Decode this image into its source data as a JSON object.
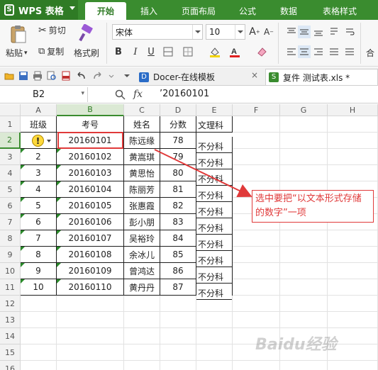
{
  "app": {
    "name": "WPS 表格"
  },
  "tabs": [
    "开始",
    "插入",
    "页面布局",
    "公式",
    "数据",
    "表格样式"
  ],
  "ribbon": {
    "cut": "剪切",
    "paste": "粘贴",
    "copy": "复制",
    "format_painter": "格式刷",
    "font_name": "宋体",
    "font_size": "10",
    "bold": "B",
    "italic": "I",
    "underline": "U",
    "merge": "合"
  },
  "doc_tabs": [
    {
      "label": "Docer-在线模板"
    },
    {
      "label": "复件 测试表.xls *"
    }
  ],
  "formula_bar": {
    "cell_ref": "B2",
    "fx": "fx",
    "content": "’20160101"
  },
  "columns": [
    "A",
    "B",
    "C",
    "D",
    "E",
    "F",
    "G",
    "H"
  ],
  "rows": [
    "1",
    "2",
    "3",
    "4",
    "5",
    "6",
    "7",
    "8",
    "9",
    "10",
    "11",
    "12",
    "13",
    "14",
    "15",
    "16"
  ],
  "table": {
    "headers": [
      "班级",
      "考号",
      "姓名",
      "分数",
      "文理科"
    ],
    "data": [
      [
        "",
        "20160101",
        "陈远缘",
        "78",
        "不分科"
      ],
      [
        "2",
        "20160102",
        "黄嵩琪",
        "79",
        "不分科"
      ],
      [
        "3",
        "20160103",
        "黄思怡",
        "80",
        "不分科"
      ],
      [
        "4",
        "20160104",
        "陈丽芳",
        "81",
        "不分科"
      ],
      [
        "5",
        "20160105",
        "张惠霞",
        "82",
        "不分科"
      ],
      [
        "6",
        "20160106",
        "彭小朋",
        "83",
        "不分科"
      ],
      [
        "7",
        "20160107",
        "吴裕玲",
        "84",
        "不分科"
      ],
      [
        "8",
        "20160108",
        "余冰儿",
        "85",
        "不分科"
      ],
      [
        "9",
        "20160109",
        "曾鸿达",
        "86",
        "不分科"
      ],
      [
        "10",
        "20160110",
        "黄丹丹",
        "87",
        "不分科"
      ]
    ]
  },
  "annotation": {
    "text": "选中要把“以文本形式存储的数字”一项"
  },
  "watermark": "Baidu经验",
  "colors": {
    "brand": "#3a8c2f",
    "annotation": "#e03a3a",
    "text_number_marker": "#2a8a2a",
    "warning": "#ffd93b"
  }
}
